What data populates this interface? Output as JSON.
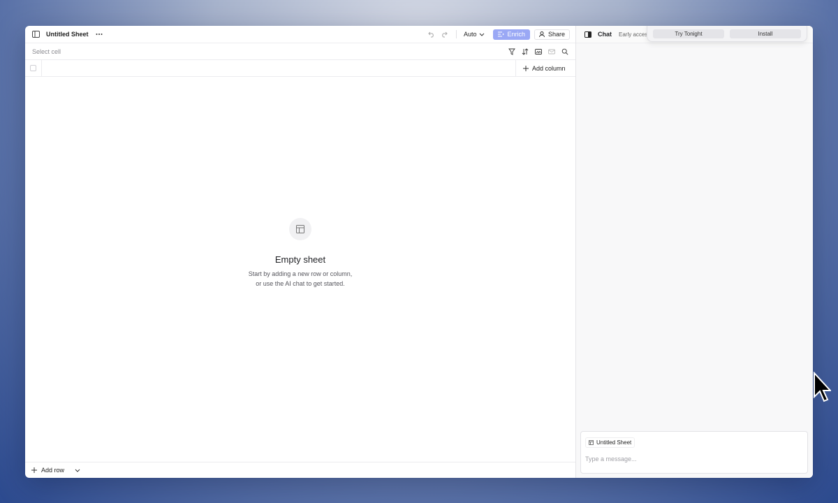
{
  "sheet": {
    "title": "Untitled Sheet",
    "mode": "Auto",
    "enrich_label": "Enrich",
    "share_label": "Share",
    "cell_placeholder": "Select cell",
    "add_column_label": "Add column",
    "empty_title": "Empty sheet",
    "empty_line1": "Start by adding a new row or column,",
    "empty_line2": "or use the AI chat to get started.",
    "add_row_label": "Add row"
  },
  "chat": {
    "title": "Chat",
    "badge": "Early acces",
    "context_label": "Untitled Sheet",
    "message_placeholder": "Type a message..."
  },
  "popup": {
    "try_label": "Try Tonight",
    "install_label": "Install"
  },
  "colors": {
    "enrich_button": "#9aa8f5",
    "background_gradient_end": "#2c4a8f"
  }
}
